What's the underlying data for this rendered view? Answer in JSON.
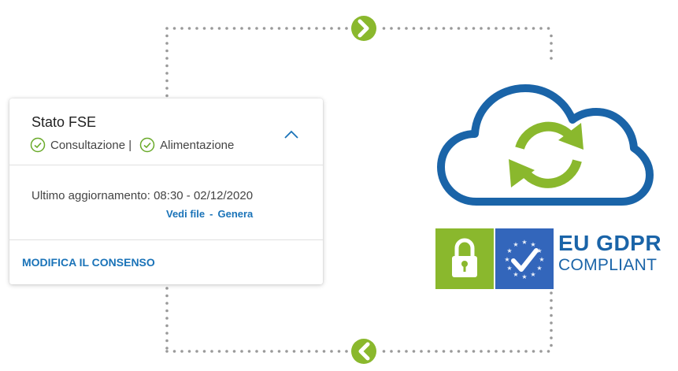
{
  "card": {
    "title": "Stato FSE",
    "status": [
      {
        "label": "Consultazione |"
      },
      {
        "label": "Alimentazione"
      }
    ],
    "last_update_label": "Ultimo aggiornamento:",
    "last_update_value": "08:30 - 02/12/2020",
    "links": {
      "view": "Vedi file",
      "separator": "-",
      "generate": "Genera"
    },
    "consent_action": "MODIFICA IL CONSENSO"
  },
  "gdpr": {
    "line1": "EU GDPR",
    "line2": "COMPLIANT"
  },
  "icons": [
    "check-circle-icon",
    "chevron-up-icon",
    "chevron-right-icon",
    "chevron-left-icon",
    "cloud-sync-icon",
    "lock-icon",
    "eu-check-icon"
  ],
  "colors": {
    "accent_green": "#8ab82d",
    "accent_blue": "#1a73b8",
    "cloud_blue": "#1a64a8",
    "eu_blue": "#3366bb"
  }
}
